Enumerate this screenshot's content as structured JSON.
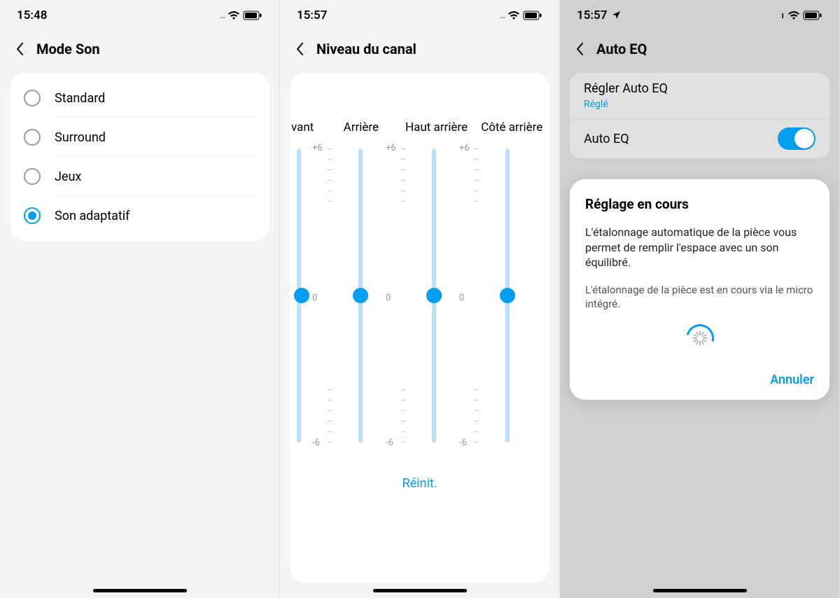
{
  "screen1": {
    "status_time": "15:48",
    "title": "Mode Son",
    "options": [
      {
        "label": "Standard",
        "selected": false
      },
      {
        "label": "Surround",
        "selected": false
      },
      {
        "label": "Jeux",
        "selected": false
      },
      {
        "label": "Son adaptatif",
        "selected": true
      }
    ]
  },
  "screen2": {
    "status_time": "15:57",
    "title": "Niveau du canal",
    "channels": [
      "vant",
      "Arrière",
      "Haut arrière",
      "Côté arrière"
    ],
    "scale_max": "+6",
    "scale_mid": "0",
    "scale_min": "-6",
    "values": [
      0,
      0,
      0,
      0
    ],
    "reset_label": "Réinit."
  },
  "screen3": {
    "status_time": "15:57",
    "title": "Auto EQ",
    "item_title": "Régler Auto EQ",
    "item_sub": "Réglé",
    "toggle_label": "Auto EQ",
    "toggle_on": true,
    "modal": {
      "title": "Réglage en cours",
      "text": "L'étalonnage automatique de la pièce vous permet de remplir l'espace avec un son équilibré.",
      "subtext": "L'étalonnage de la pièce est en cours via le micro intégré.",
      "cancel": "Annuler"
    }
  }
}
